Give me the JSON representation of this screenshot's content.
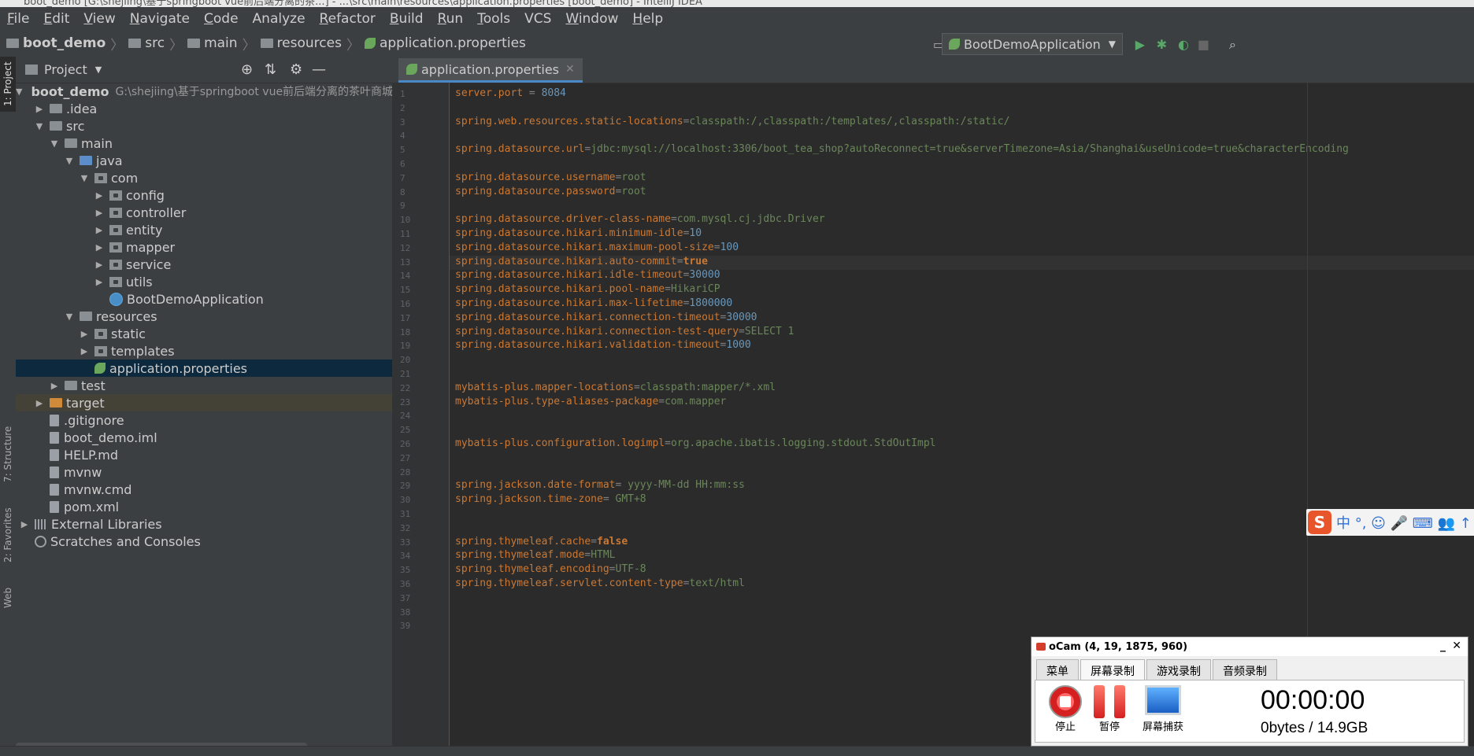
{
  "window": {
    "title": "boot_demo [G:\\shejiing\\基于springboot vue前后端分离的茶...] - ...\\src\\main\\resources\\application.properties [boot_demo] - IntelliJ IDEA"
  },
  "menu": [
    {
      "label": "File",
      "u": "F",
      "rest": "ile"
    },
    {
      "label": "Edit",
      "u": "E",
      "rest": "dit"
    },
    {
      "label": "View",
      "u": "V",
      "rest": "iew"
    },
    {
      "label": "Navigate",
      "u": "N",
      "rest": "avigate"
    },
    {
      "label": "Code",
      "u": "C",
      "rest": "ode"
    },
    {
      "label": "Analyze",
      "u": "",
      "rest": "Analyze"
    },
    {
      "label": "Refactor",
      "u": "R",
      "rest": "efactor"
    },
    {
      "label": "Build",
      "u": "B",
      "rest": "uild"
    },
    {
      "label": "Run",
      "u": "R",
      "rest": "un"
    },
    {
      "label": "Tools",
      "u": "T",
      "rest": "ools"
    },
    {
      "label": "VCS",
      "u": "",
      "rest": "VCS"
    },
    {
      "label": "Window",
      "u": "W",
      "rest": "indow"
    },
    {
      "label": "Help",
      "u": "H",
      "rest": "elp"
    }
  ],
  "breadcrumb": [
    "boot_demo",
    "src",
    "main",
    "resources",
    "application.properties"
  ],
  "run_config": "BootDemoApplication",
  "left_strip": {
    "project": "1: Project",
    "structure": "7: Structure",
    "favorites": "2: Favorites",
    "web": "Web"
  },
  "project_panel": {
    "title": "Project"
  },
  "tree": [
    {
      "label": "boot_demo",
      "extra": "G:\\shejiing\\基于springboot vue前后端分离的茶叶商城",
      "indent": 0,
      "arrow": "▼",
      "icon": "module",
      "bold": true
    },
    {
      "label": ".idea",
      "indent": 1,
      "arrow": "▶",
      "icon": "folder"
    },
    {
      "label": "src",
      "indent": 1,
      "arrow": "▼",
      "icon": "folder"
    },
    {
      "label": "main",
      "indent": 2,
      "arrow": "▼",
      "icon": "folder"
    },
    {
      "label": "java",
      "indent": 3,
      "arrow": "▼",
      "icon": "folder-blue"
    },
    {
      "label": "com",
      "indent": 4,
      "arrow": "▼",
      "icon": "package"
    },
    {
      "label": "config",
      "indent": 5,
      "arrow": "▶",
      "icon": "package"
    },
    {
      "label": "controller",
      "indent": 5,
      "arrow": "▶",
      "icon": "package"
    },
    {
      "label": "entity",
      "indent": 5,
      "arrow": "▶",
      "icon": "package"
    },
    {
      "label": "mapper",
      "indent": 5,
      "arrow": "▶",
      "icon": "package"
    },
    {
      "label": "service",
      "indent": 5,
      "arrow": "▶",
      "icon": "package"
    },
    {
      "label": "utils",
      "indent": 5,
      "arrow": "▶",
      "icon": "package"
    },
    {
      "label": "BootDemoApplication",
      "indent": 5,
      "arrow": "",
      "icon": "class"
    },
    {
      "label": "resources",
      "indent": 3,
      "arrow": "▼",
      "icon": "folder-res"
    },
    {
      "label": "static",
      "indent": 4,
      "arrow": "▶",
      "icon": "package"
    },
    {
      "label": "templates",
      "indent": 4,
      "arrow": "▶",
      "icon": "package"
    },
    {
      "label": "application.properties",
      "indent": 4,
      "arrow": "",
      "icon": "leaf",
      "selected": true
    },
    {
      "label": "test",
      "indent": 2,
      "arrow": "▶",
      "icon": "folder"
    },
    {
      "label": "target",
      "indent": 1,
      "arrow": "▶",
      "icon": "folder-orange",
      "highlight": true
    },
    {
      "label": ".gitignore",
      "indent": 1,
      "arrow": "",
      "icon": "file"
    },
    {
      "label": "boot_demo.iml",
      "indent": 1,
      "arrow": "",
      "icon": "file"
    },
    {
      "label": "HELP.md",
      "indent": 1,
      "arrow": "",
      "icon": "file"
    },
    {
      "label": "mvnw",
      "indent": 1,
      "arrow": "",
      "icon": "file"
    },
    {
      "label": "mvnw.cmd",
      "indent": 1,
      "arrow": "",
      "icon": "file"
    },
    {
      "label": "pom.xml",
      "indent": 1,
      "arrow": "",
      "icon": "maven"
    },
    {
      "label": "External Libraries",
      "indent": 0,
      "arrow": "▶",
      "icon": "lib"
    },
    {
      "label": "Scratches and Consoles",
      "indent": 0,
      "arrow": "",
      "icon": "scratch"
    }
  ],
  "editor": {
    "tab": "application.properties",
    "current_line": 13,
    "lines": [
      {
        "n": 1,
        "k": "server.port",
        "e": " = ",
        "v": "8084",
        "t": "n"
      },
      {
        "n": 2
      },
      {
        "n": 3,
        "k": "spring.web.resources.static-locations",
        "e": "=",
        "v": "classpath:/,classpath:/templates/,classpath:/static/",
        "t": "v"
      },
      {
        "n": 4
      },
      {
        "n": 5,
        "k": "spring.datasource.url",
        "e": "=",
        "v": "jdbc:mysql://localhost:3306/boot_tea_shop?autoReconnect=true&serverTimezone=Asia/Shanghai&useUnicode=true&characterEncoding",
        "t": "v"
      },
      {
        "n": 6
      },
      {
        "n": 7,
        "k": "spring.datasource.username",
        "e": "=",
        "v": "root",
        "t": "v"
      },
      {
        "n": 8,
        "k": "spring.datasource.password",
        "e": "=",
        "v": "root",
        "t": "v"
      },
      {
        "n": 9
      },
      {
        "n": 10,
        "k": "spring.datasource.driver-class-name",
        "e": "=",
        "v": "com.mysql.cj.jdbc.Driver",
        "t": "v"
      },
      {
        "n": 11,
        "k": "spring.datasource.hikari.minimum-idle",
        "e": "=",
        "v": "10",
        "t": "n"
      },
      {
        "n": 12,
        "k": "spring.datasource.hikari.maximum-pool-size",
        "e": "=",
        "v": "100",
        "t": "n"
      },
      {
        "n": 13,
        "k": "spring.datasource.hikari.auto-commit",
        "e": "=",
        "v": "true",
        "t": "b"
      },
      {
        "n": 14,
        "k": "spring.datasource.hikari.idle-timeout",
        "e": "=",
        "v": "30000",
        "t": "n"
      },
      {
        "n": 15,
        "k": "spring.datasource.hikari.pool-name",
        "e": "=",
        "v": "HikariCP",
        "t": "v"
      },
      {
        "n": 16,
        "k": "spring.datasource.hikari.max-lifetime",
        "e": "=",
        "v": "1800000",
        "t": "n"
      },
      {
        "n": 17,
        "k": "spring.datasource.hikari.connection-timeout",
        "e": "=",
        "v": "30000",
        "t": "n"
      },
      {
        "n": 18,
        "k": "spring.datasource.hikari.connection-test-query",
        "e": "=",
        "v": "SELECT 1",
        "t": "v"
      },
      {
        "n": 19,
        "k": "spring.datasource.hikari.validation-timeout",
        "e": "=",
        "v": "1000",
        "t": "n"
      },
      {
        "n": 20
      },
      {
        "n": 21
      },
      {
        "n": 22,
        "k": "mybatis-plus.mapper-locations",
        "e": "=",
        "v": "classpath:mapper/*.xml",
        "t": "v"
      },
      {
        "n": 23,
        "k": "mybatis-plus.type-aliases-package",
        "e": "=",
        "v": "com.mapper",
        "t": "v"
      },
      {
        "n": 24
      },
      {
        "n": 25
      },
      {
        "n": 26,
        "k": "mybatis-plus.configuration.logimpl",
        "e": "=",
        "v": "org.apache.ibatis.logging.stdout.StdOutImpl",
        "t": "v"
      },
      {
        "n": 27
      },
      {
        "n": 28
      },
      {
        "n": 29,
        "k": "spring.jackson.date-format",
        "e": "= ",
        "v": "yyyy-MM-dd HH:mm:ss",
        "t": "v"
      },
      {
        "n": 30,
        "k": "spring.jackson.time-zone",
        "e": "= ",
        "v": "GMT+8",
        "t": "v"
      },
      {
        "n": 31
      },
      {
        "n": 32
      },
      {
        "n": 33,
        "k": "spring.thymeleaf.cache",
        "e": "=",
        "v": "false",
        "t": "b"
      },
      {
        "n": 34,
        "k": "spring.thymeleaf.mode",
        "e": "=",
        "v": "HTML",
        "t": "v"
      },
      {
        "n": 35,
        "k": "spring.thymeleaf.encoding",
        "e": "=",
        "v": "UTF-8",
        "t": "v"
      },
      {
        "n": 36,
        "k": "spring.thymeleaf.servlet.content-type",
        "e": "=",
        "v": "text/html",
        "t": "v"
      },
      {
        "n": 37
      },
      {
        "n": 38
      },
      {
        "n": 39
      }
    ]
  },
  "ime": {
    "logo": "S",
    "glyphs": "中 °, ☺ 🎤 ⌨ 👥 ↑"
  },
  "ocam": {
    "title": "oCam (4, 19, 1875, 960)",
    "tabs": [
      "菜单",
      "屏幕录制",
      "游戏录制",
      "音频录制"
    ],
    "active_tab": 1,
    "buttons": {
      "stop": "停止",
      "pause": "暂停",
      "capture": "屏幕捕获"
    },
    "time": "00:00:00",
    "size": "0bytes / 14.9GB"
  }
}
